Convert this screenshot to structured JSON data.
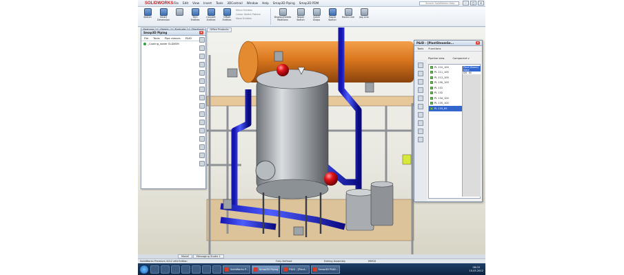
{
  "app": {
    "logo": "SOLIDWORKS",
    "menu": [
      "File",
      "Edit",
      "View",
      "Insert",
      "Tools",
      "3DContrail",
      "Window",
      "Help",
      "Smap3D Piping",
      "Smap3D PDM"
    ],
    "search_placeholder": "Search SolidWorks Help"
  },
  "ribbon": {
    "buttons": [
      {
        "label": "Sketch"
      },
      {
        "label": "Smart Dimension"
      },
      {
        "label": "Trim Entities"
      },
      {
        "label": "Convert Entities"
      },
      {
        "label": "Offset Entities"
      }
    ],
    "small": [
      "Mirror Entities",
      "Linear Sketch Pattern",
      "Move Entities"
    ],
    "buttons2": [
      {
        "label": "Display/Delete Relations"
      },
      {
        "label": "Repair Sketch"
      },
      {
        "label": "Quick Snaps"
      },
      {
        "label": "Rapid Sketch"
      },
      {
        "label": "Route Line"
      },
      {
        "label": "Jog Line"
      }
    ]
  },
  "doc_tabs": [
    "Features",
    "Sketch",
    "Evaluate",
    "DimXpert",
    "Office Products"
  ],
  "piping_panel": {
    "title": "Smap3D Piping",
    "menu": [
      "File",
      "Tools",
      "Pipe classes",
      "P&ID"
    ],
    "tree": [
      "_Cooling_water SLDASM"
    ]
  },
  "pid_panel": {
    "title": "P&ID - [PlantSteamGe...",
    "menu": [
      "Tools",
      "Functions"
    ],
    "view_options": [
      "Pipeline view",
      "Component v"
    ],
    "rows": [
      "PL 110_100",
      "PL 111_100",
      "PL 112_100",
      "PL 130_100",
      "PL 131",
      "PL 132",
      "PL 134_100",
      "PL 135_100",
      "PL 133_65"
    ],
    "selected_row": "PL 133_65",
    "prop_header": "Plant (Steam) Gene",
    "props": [
      {
        "k": "DN",
        "v": "80"
      }
    ]
  },
  "bottom_tabs": [
    "Model",
    "Messaging Studio 1"
  ],
  "status": {
    "left": "SolidWorks Premium 2012 x64 Edition",
    "center": "Fully Defined",
    "mode": "Editing Assembly",
    "units": "MMGS"
  },
  "taskbar": {
    "items": [
      "SolidWorks P...",
      "Smap3D Piping",
      "P&ID - [Plant...",
      "Smap3D P&ID..."
    ],
    "active": "Smap3D Piping",
    "time": "08:03",
    "date": "10.05.2012"
  }
}
